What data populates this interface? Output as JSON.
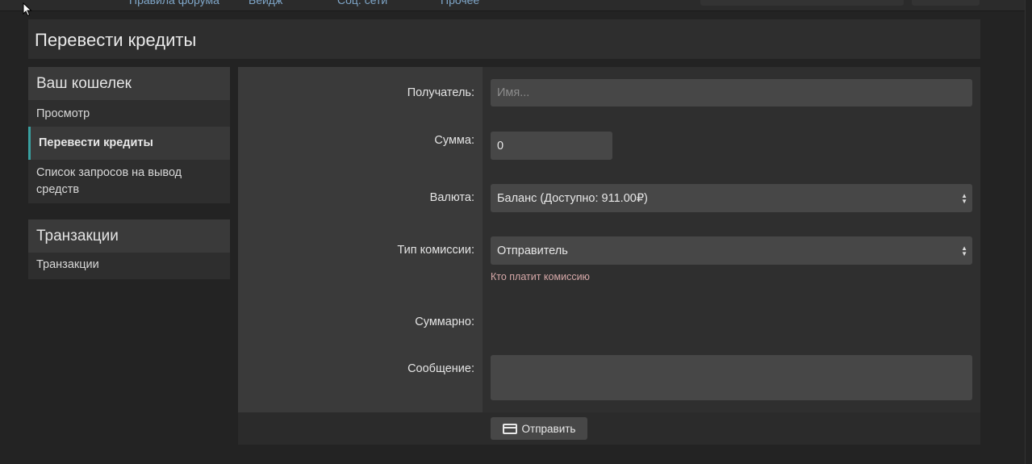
{
  "topnav": {
    "items": [
      "Правила форума",
      "Бейдж",
      "Соц. сети",
      "Прочее"
    ]
  },
  "page": {
    "title": "Перевести кредиты"
  },
  "sidebar": {
    "wallet": {
      "heading": "Ваш кошелек",
      "items": [
        {
          "label": "Просмотр",
          "active": false
        },
        {
          "label": "Перевести кредиты",
          "active": true
        },
        {
          "label": "Список запросов на вывод средств",
          "active": false
        }
      ]
    },
    "transactions": {
      "heading": "Транзакции",
      "items": [
        {
          "label": "Транзакции",
          "active": false
        }
      ]
    }
  },
  "form": {
    "recipient": {
      "label": "Получатель:",
      "placeholder": "Имя...",
      "value": ""
    },
    "amount": {
      "label": "Сумма:",
      "value": "0"
    },
    "currency": {
      "label": "Валюта:",
      "selected": "Баланс (Доступно: 911.00₽)"
    },
    "fee_type": {
      "label": "Тип комиссии:",
      "selected": "Отправитель",
      "hint": "Кто платит комиссию"
    },
    "total": {
      "label": "Суммарно:",
      "value": ""
    },
    "message": {
      "label": "Сообщение:",
      "value": ""
    },
    "submit_label": "Отправить"
  },
  "colors": {
    "background": "#232323",
    "panel": "#2e2e2e",
    "accent": "#39a0a0",
    "hint": "#d7a9a9"
  }
}
